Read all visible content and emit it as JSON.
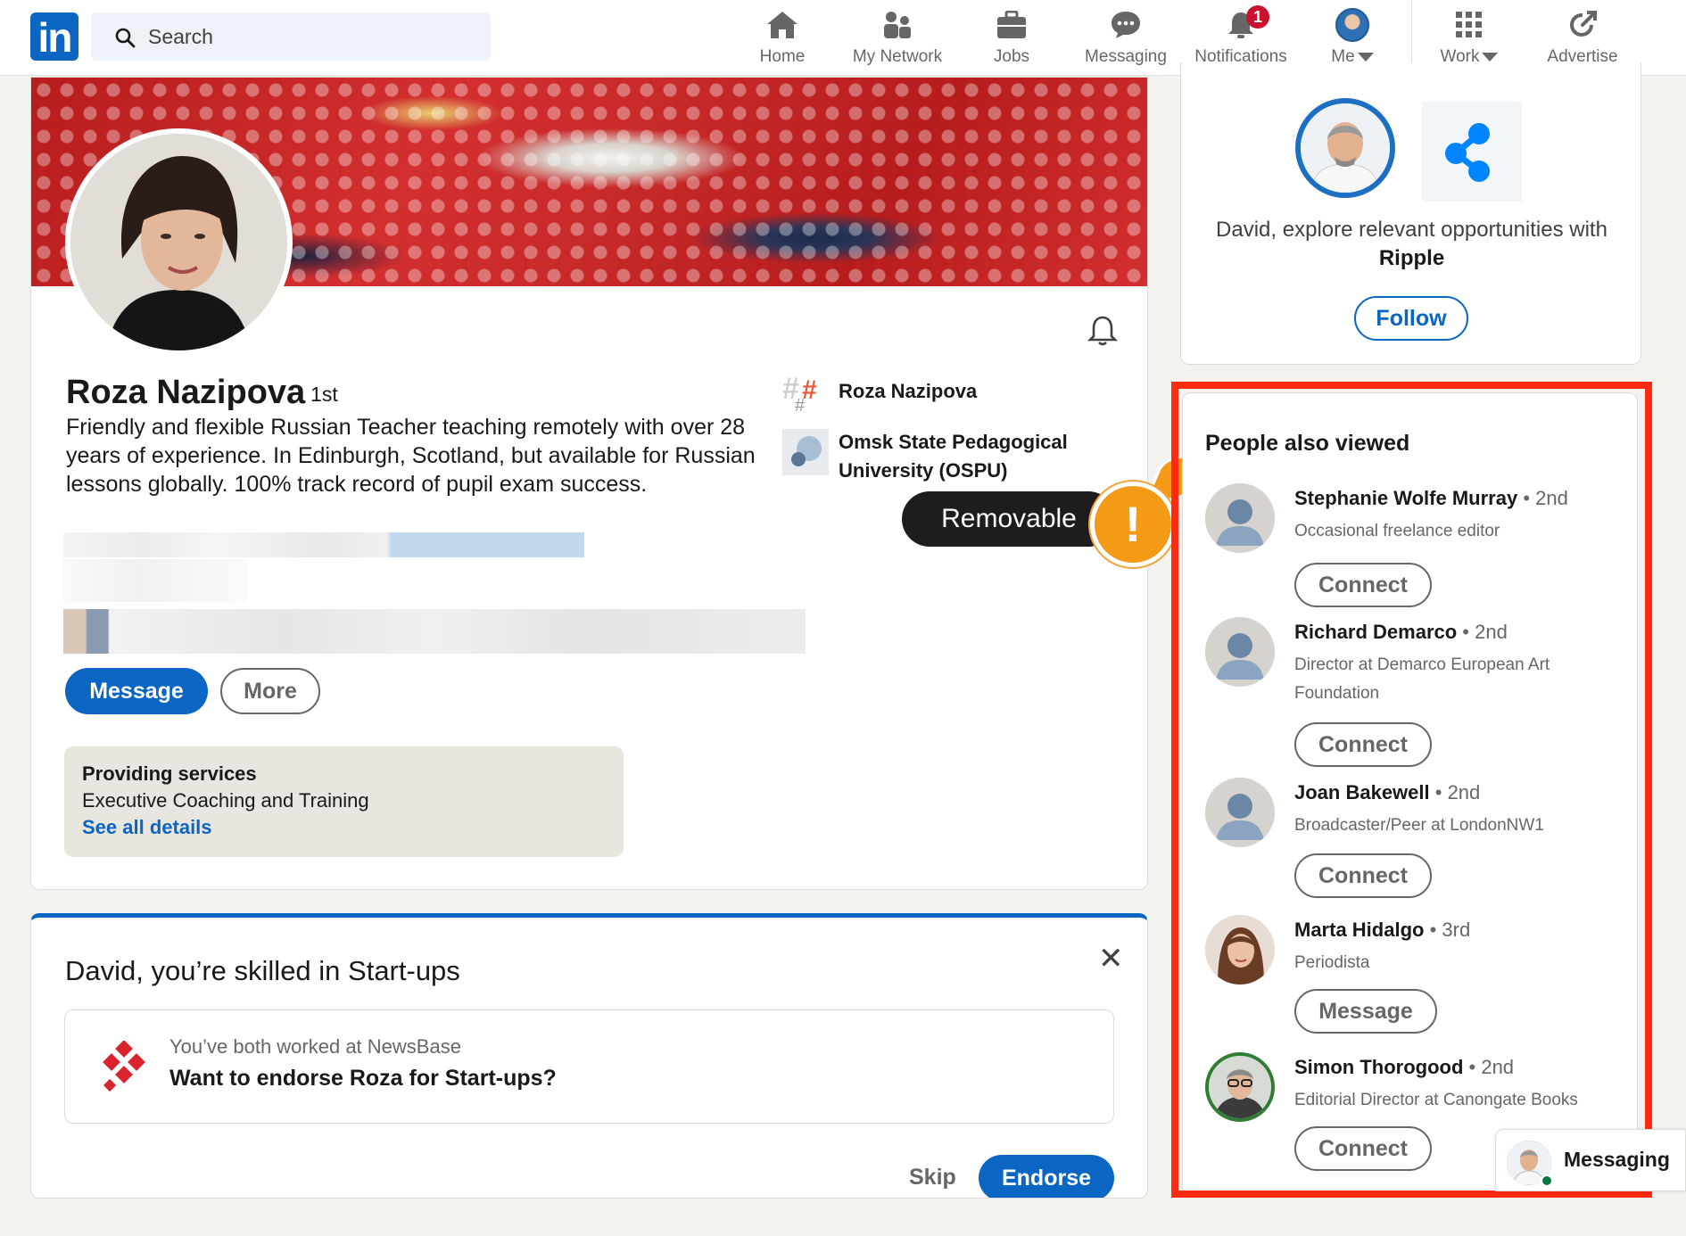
{
  "nav": {
    "logo": "in",
    "search_placeholder": "Search",
    "items": [
      {
        "label": "Home",
        "icon": "home-icon"
      },
      {
        "label": "My Network",
        "icon": "network-icon"
      },
      {
        "label": "Jobs",
        "icon": "jobs-icon"
      },
      {
        "label": "Messaging",
        "icon": "messaging-icon"
      },
      {
        "label": "Notifications",
        "icon": "bell-icon",
        "badge": "1"
      },
      {
        "label": "Me",
        "icon": "avatar"
      },
      {
        "label": "Work",
        "icon": "grid-icon"
      },
      {
        "label": "Advertise",
        "icon": "advertise-icon"
      }
    ]
  },
  "profile": {
    "name": "Roza Nazipova",
    "degree": "· 1st",
    "headline": "Friendly and flexible Russian Teacher teaching remotely with over 28 years of experience. In Edinburgh, Scotland, but available for Russian lessons globally. 100% track record of pupil exam success.",
    "orgs": [
      "Roza Nazipova",
      "Omsk State Pedagogical University (OSPU)"
    ],
    "buttons": {
      "message": "Message",
      "more": "More"
    },
    "services": {
      "title": "Providing services",
      "detail": "Executive Coaching and Training",
      "link": "See all details"
    }
  },
  "tooltip": {
    "label": "Removable",
    "icon": "!"
  },
  "endorse": {
    "title": "David, you’re skilled in Start-ups",
    "subtitle": "You’ve both worked at NewsBase",
    "question": "Want to endorse Roza for Start-ups?",
    "skip": "Skip",
    "endorse": "Endorse",
    "close": "✕"
  },
  "ripple": {
    "text_prefix": "David, explore relevant opportunities with ",
    "company": "Ripple",
    "follow": "Follow"
  },
  "people_also_viewed": {
    "title": "People also viewed",
    "people": [
      {
        "name": "Stephanie Wolfe Murray",
        "degree": " • 2nd",
        "role": "Occasional freelance editor",
        "action": "Connect"
      },
      {
        "name": "Richard Demarco",
        "degree": " • 2nd",
        "role": "Director at Demarco European Art Foundation",
        "action": "Connect"
      },
      {
        "name": "Joan Bakewell",
        "degree": " • 2nd",
        "role": "Broadcaster/Peer at LondonNW1",
        "action": "Connect"
      },
      {
        "name": "Marta Hidalgo",
        "degree": " • 3rd",
        "role": "Periodista",
        "action": "Message"
      },
      {
        "name": "Simon Thorogood",
        "degree": " • 2nd",
        "role": "Editorial Director at Canongate Books",
        "action": "Connect"
      }
    ]
  },
  "messaging_pill": {
    "label": "Messaging"
  },
  "colors": {
    "brand": "#0a66c2",
    "highlight_frame": "#ff2a12",
    "warning": "#f59a16",
    "badge": "#cb112d"
  }
}
